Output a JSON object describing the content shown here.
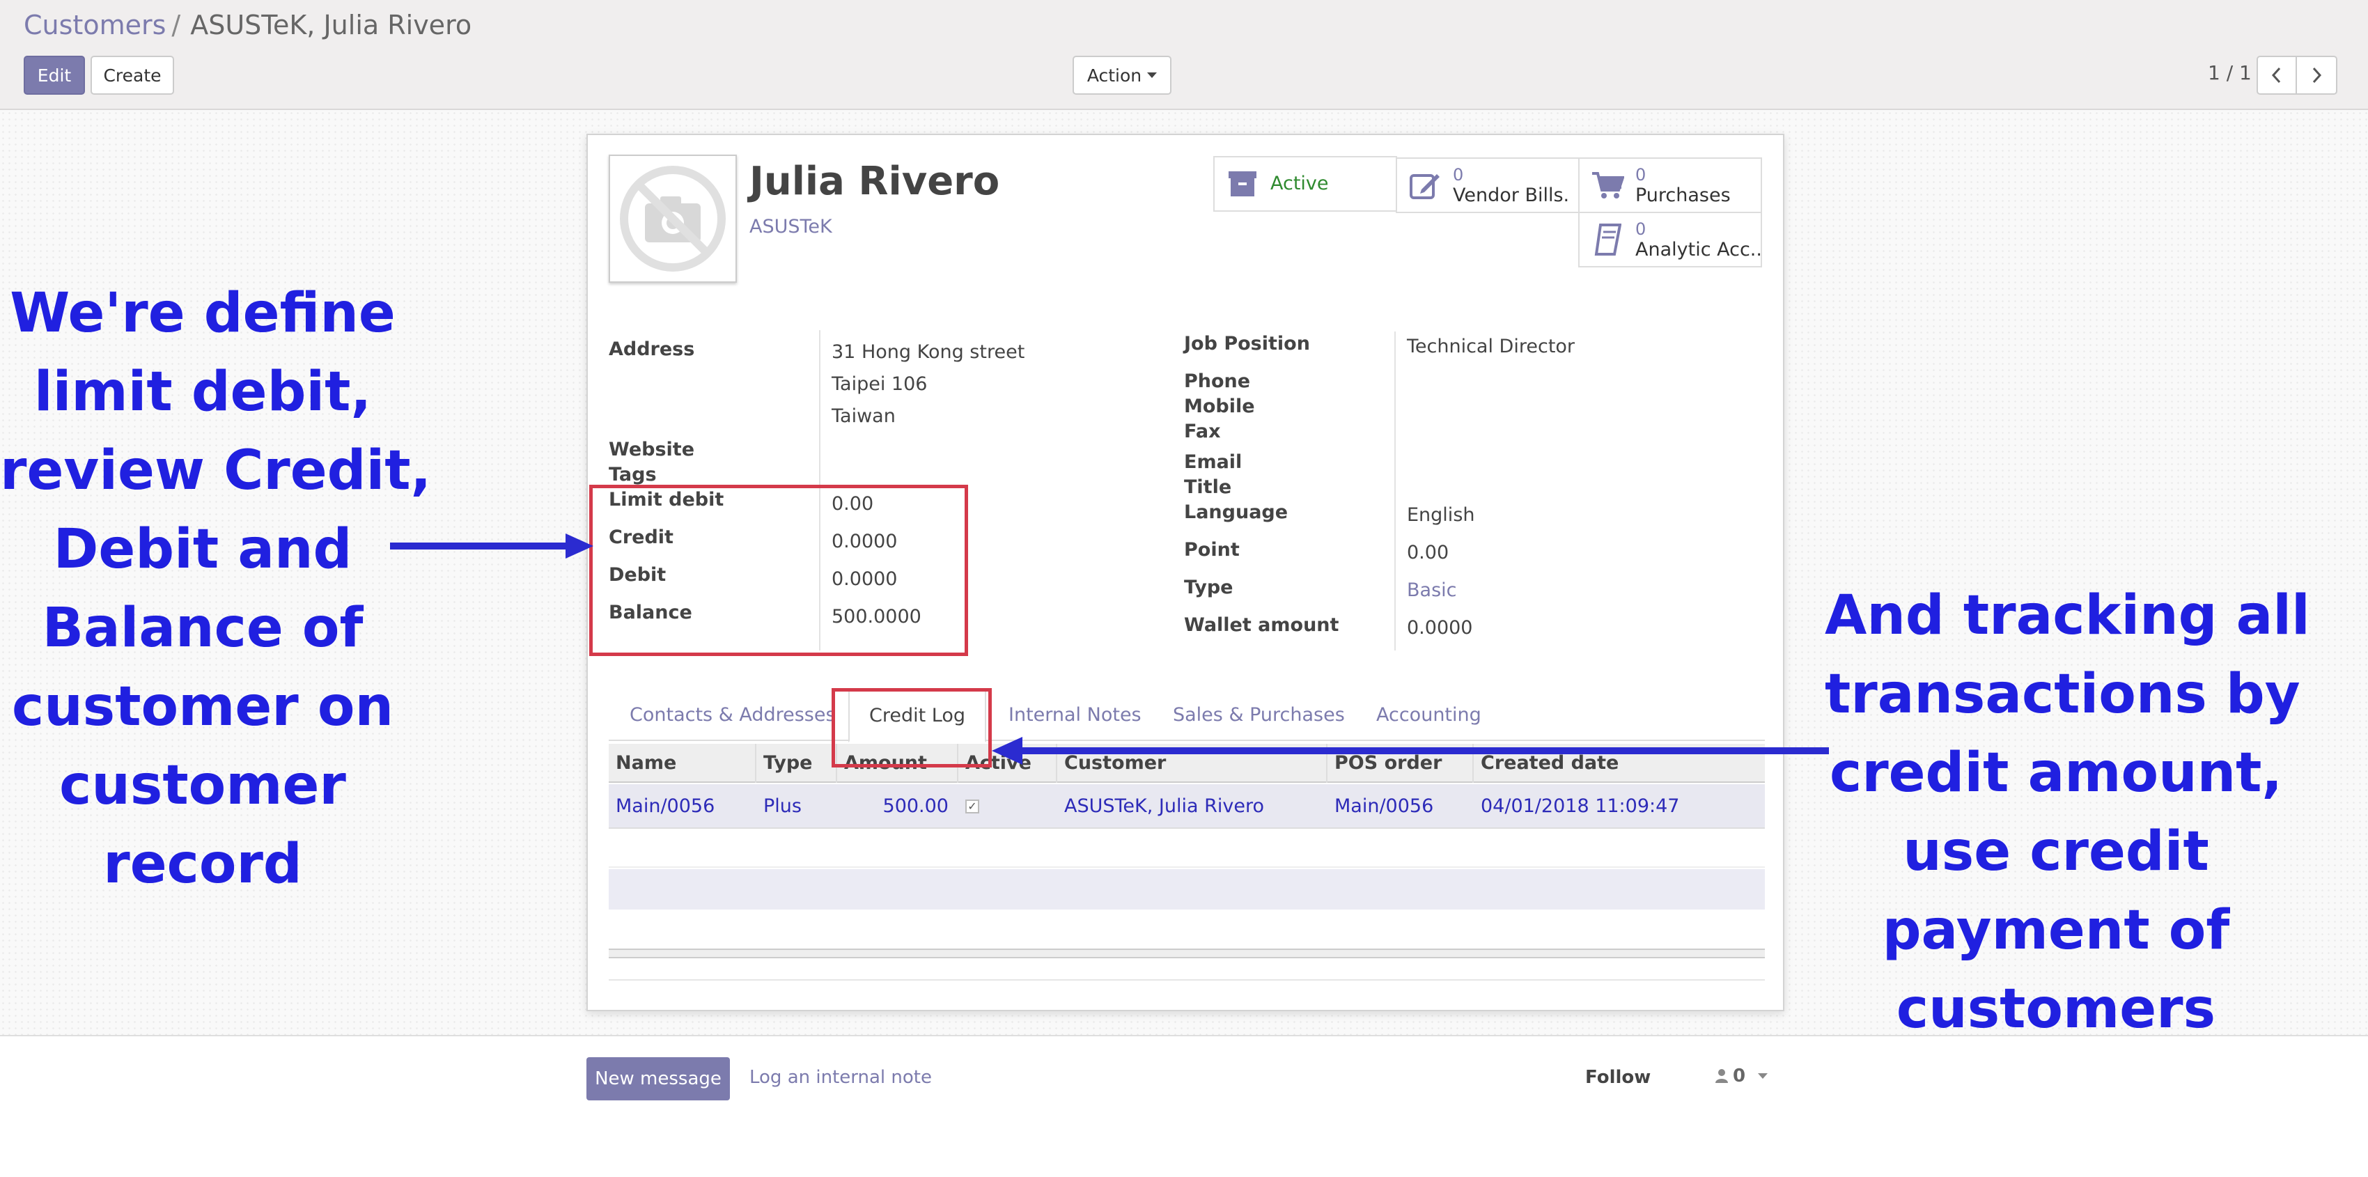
{
  "breadcrumb": {
    "parent": "Customers",
    "separator": "/",
    "current": "ASUSTeK, Julia Rivero"
  },
  "toolbar": {
    "edit_label": "Edit",
    "create_label": "Create",
    "action_label": "Action"
  },
  "pager": {
    "value": "1 / 1"
  },
  "partner": {
    "name": "Julia Rivero",
    "company": "ASUSTeK"
  },
  "smart_buttons": {
    "active": {
      "label": "Active"
    },
    "vendor_bills": {
      "count": "0",
      "label": "Vendor Bills."
    },
    "purchases": {
      "count": "0",
      "label": "Purchases"
    },
    "analytic": {
      "count": "0",
      "label": "Analytic Acc..."
    }
  },
  "left_fields": {
    "address_label": "Address",
    "address_lines": [
      "31 Hong Kong street",
      "Taipei 106",
      "Taiwan"
    ],
    "website_label": "Website",
    "tags_label": "Tags",
    "limit_debit_label": "Limit debit",
    "limit_debit": "0.00",
    "credit_label": "Credit",
    "credit": "0.0000",
    "debit_label": "Debit",
    "debit": "0.0000",
    "balance_label": "Balance",
    "balance": "500.0000"
  },
  "right_fields": {
    "job_position_label": "Job Position",
    "job_position": "Technical Director",
    "phone_label": "Phone",
    "mobile_label": "Mobile",
    "fax_label": "Fax",
    "email_label": "Email",
    "title_label": "Title",
    "language_label": "Language",
    "language": "English",
    "point_label": "Point",
    "point": "0.00",
    "type_label": "Type",
    "type": "Basic",
    "wallet_label": "Wallet amount",
    "wallet": "0.0000"
  },
  "tabs": [
    "Contacts & Addresses",
    "Credit Log",
    "Internal Notes",
    "Sales & Purchases",
    "Accounting"
  ],
  "credit_log": {
    "columns": [
      "Name",
      "Type",
      "Amount",
      "Active",
      "Customer",
      "POS order",
      "Created date"
    ],
    "rows": [
      {
        "name": "Main/0056",
        "type": "Plus",
        "amount": "500.00",
        "active": true,
        "customer": "ASUSTeK, Julia Rivero",
        "pos_order": "Main/0056",
        "created": "04/01/2018 11:09:47"
      }
    ]
  },
  "annotations": {
    "left": [
      "We're define",
      "limit debit,",
      "review Credit,",
      "Debit and",
      "Balance of",
      "customer on",
      "customer",
      "record"
    ],
    "right": [
      "And tracking all",
      "transactions by",
      "credit amount,",
      "use credit",
      "payment of",
      "customers"
    ]
  },
  "chatter": {
    "new_message": "New message",
    "log_note": "Log an internal note",
    "follow": "Follow",
    "followers": "0"
  },
  "colors": {
    "primary": "#7c7bad",
    "annotation": "#2020e0",
    "highlight_box": "#d43a4a",
    "active_green": "#2f8a2f"
  }
}
